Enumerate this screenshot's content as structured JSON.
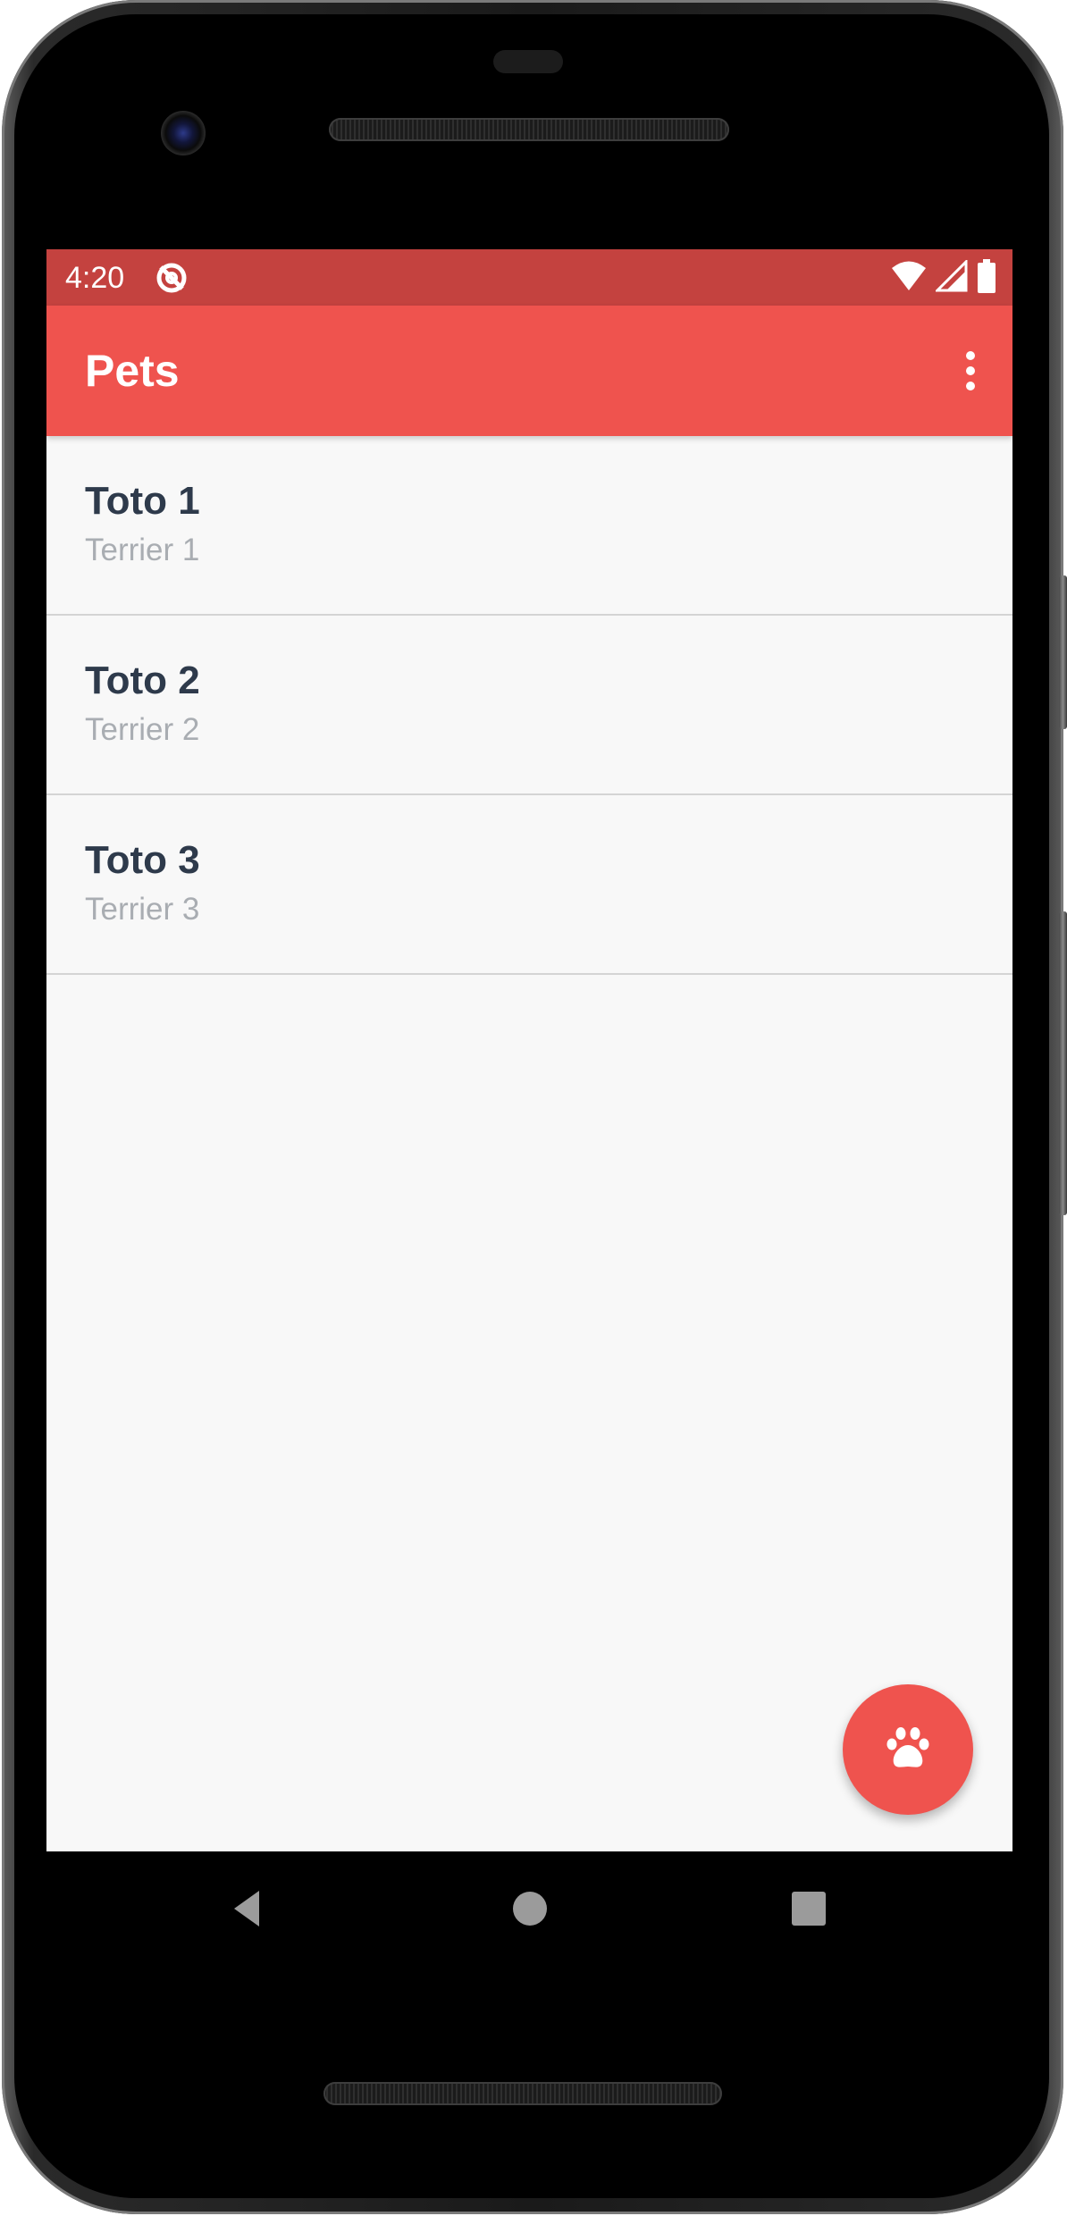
{
  "status_bar": {
    "time": "4:20",
    "icons": [
      "app-notification-icon",
      "wifi-icon",
      "cell-signal-icon",
      "battery-icon"
    ]
  },
  "app_bar": {
    "title": "Pets",
    "overflow_icon": "more-vert-icon"
  },
  "pets": [
    {
      "name": "Toto 1",
      "breed": "Terrier 1"
    },
    {
      "name": "Toto 2",
      "breed": "Terrier 2"
    },
    {
      "name": "Toto 3",
      "breed": "Terrier 3"
    }
  ],
  "fab": {
    "icon": "paw-icon"
  },
  "navigation": {
    "buttons": [
      "back-icon",
      "home-icon",
      "recents-icon"
    ]
  },
  "colors": {
    "status_bar": "#c4423f",
    "app_bar": "#ef534e",
    "fab": "#ef534e",
    "background": "#f8f8f8",
    "pet_name": "#2e3a4b",
    "pet_breed": "#a9adb2",
    "divider": "#d4d4d4"
  }
}
